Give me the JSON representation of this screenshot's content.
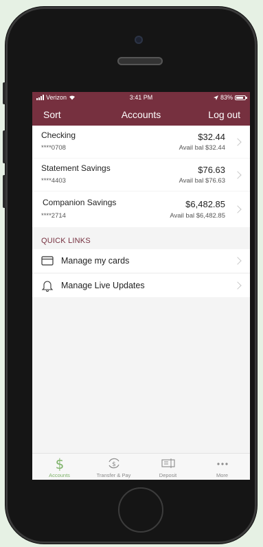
{
  "status_bar": {
    "carrier": "Verizon",
    "time": "3:41 PM",
    "battery": "83%"
  },
  "nav": {
    "sort_label": "Sort",
    "title": "Accounts",
    "logout_label": "Log out"
  },
  "accounts": [
    {
      "name": "Checking",
      "number": "****0708",
      "balance": "$32.44",
      "avail": "Avail bal $32.44"
    },
    {
      "name": "Statement Savings",
      "number": "****4403",
      "balance": "$76.63",
      "avail": "Avail bal $76.63"
    },
    {
      "name": "Companion Savings",
      "number": "****2714",
      "balance": "$6,482.85",
      "avail": "Avail bal $6,482.85"
    }
  ],
  "quick_links": {
    "header": "QUICK LINKS",
    "items": [
      {
        "label": "Manage my cards",
        "icon": "card-icon"
      },
      {
        "label": "Manage Live Updates",
        "icon": "bell-icon"
      }
    ]
  },
  "tabs": [
    {
      "label": "Accounts",
      "icon": "dollar-icon",
      "active": true
    },
    {
      "label": "Transfer & Pay",
      "icon": "transfer-icon",
      "active": false
    },
    {
      "label": "Deposit",
      "icon": "check-deposit-icon",
      "active": false
    },
    {
      "label": "More",
      "icon": "more-dots-icon",
      "active": false
    }
  ],
  "colors": {
    "brand": "#76303f",
    "active_tab": "#7fb36a",
    "background": "#e6f1e4"
  }
}
